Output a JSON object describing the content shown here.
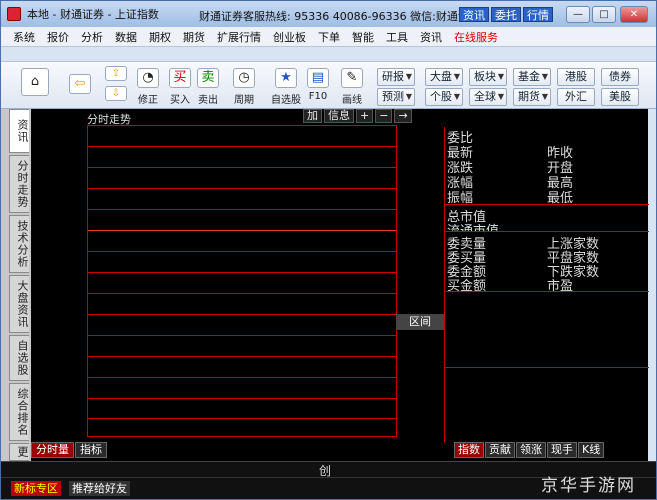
{
  "titlebar": {
    "title": "本地 - 财通证券 - 上证指数",
    "hotline": "财通证券客服热线: 95336 40086-96336 微信:财通证券",
    "btns": [
      "资讯",
      "委托",
      "行情"
    ],
    "ctrls": [
      "—",
      "□",
      "✕"
    ]
  },
  "menu": [
    "系统",
    "报价",
    "分析",
    "数据",
    "期权",
    "期货",
    "扩展行情",
    "创业板",
    "下单",
    "智能",
    "工具",
    "资讯",
    "在线服务"
  ],
  "toolbar": {
    "zhengzheng": "修正",
    "buy": "买入",
    "sell": "卖出",
    "cycle": "周期",
    "zixuan": "自选股",
    "f10": "F10",
    "draw": "画线",
    "yanbao": "研报",
    "yuce": "预测",
    "dapan": "大盘",
    "gegu": "个股",
    "bankuai": "板块",
    "quanqiu": "全球",
    "jijin": "基金",
    "qihuo": "期货",
    "ganggu": "港股",
    "waihui": "外汇",
    "zhaiquan": "债券",
    "meigu": "美股"
  },
  "sidetabs": [
    "资讯",
    "分时走势",
    "技术分析",
    "大盘资讯",
    "自选股",
    "综合排名",
    "更"
  ],
  "chart": {
    "title": "分时走势",
    "hdr": [
      "加",
      "信息",
      "+",
      "−",
      "→"
    ],
    "qujian": "区间",
    "btabs": [
      "分时量",
      "指标"
    ]
  },
  "right": {
    "labels1": [
      "委比",
      "最新",
      "涨跌",
      "涨幅",
      "振幅"
    ],
    "labels1b": [
      "昨收",
      "开盘",
      "最高",
      "最低"
    ],
    "labels2": [
      "总市值",
      "流通市值"
    ],
    "labels3": [
      "委卖量",
      "委买量",
      "委金额",
      "买金额"
    ],
    "labels3b": [
      "上涨家数",
      "平盘家数",
      "下跌家数",
      "市盈"
    ],
    "tabs": [
      "指数",
      "贡献",
      "领涨",
      "现手",
      "K线"
    ]
  },
  "bottom": {
    "chuang": "创",
    "b1": "新标专区",
    "b2": "推荐给好友"
  },
  "watermark": "京华手游网"
}
